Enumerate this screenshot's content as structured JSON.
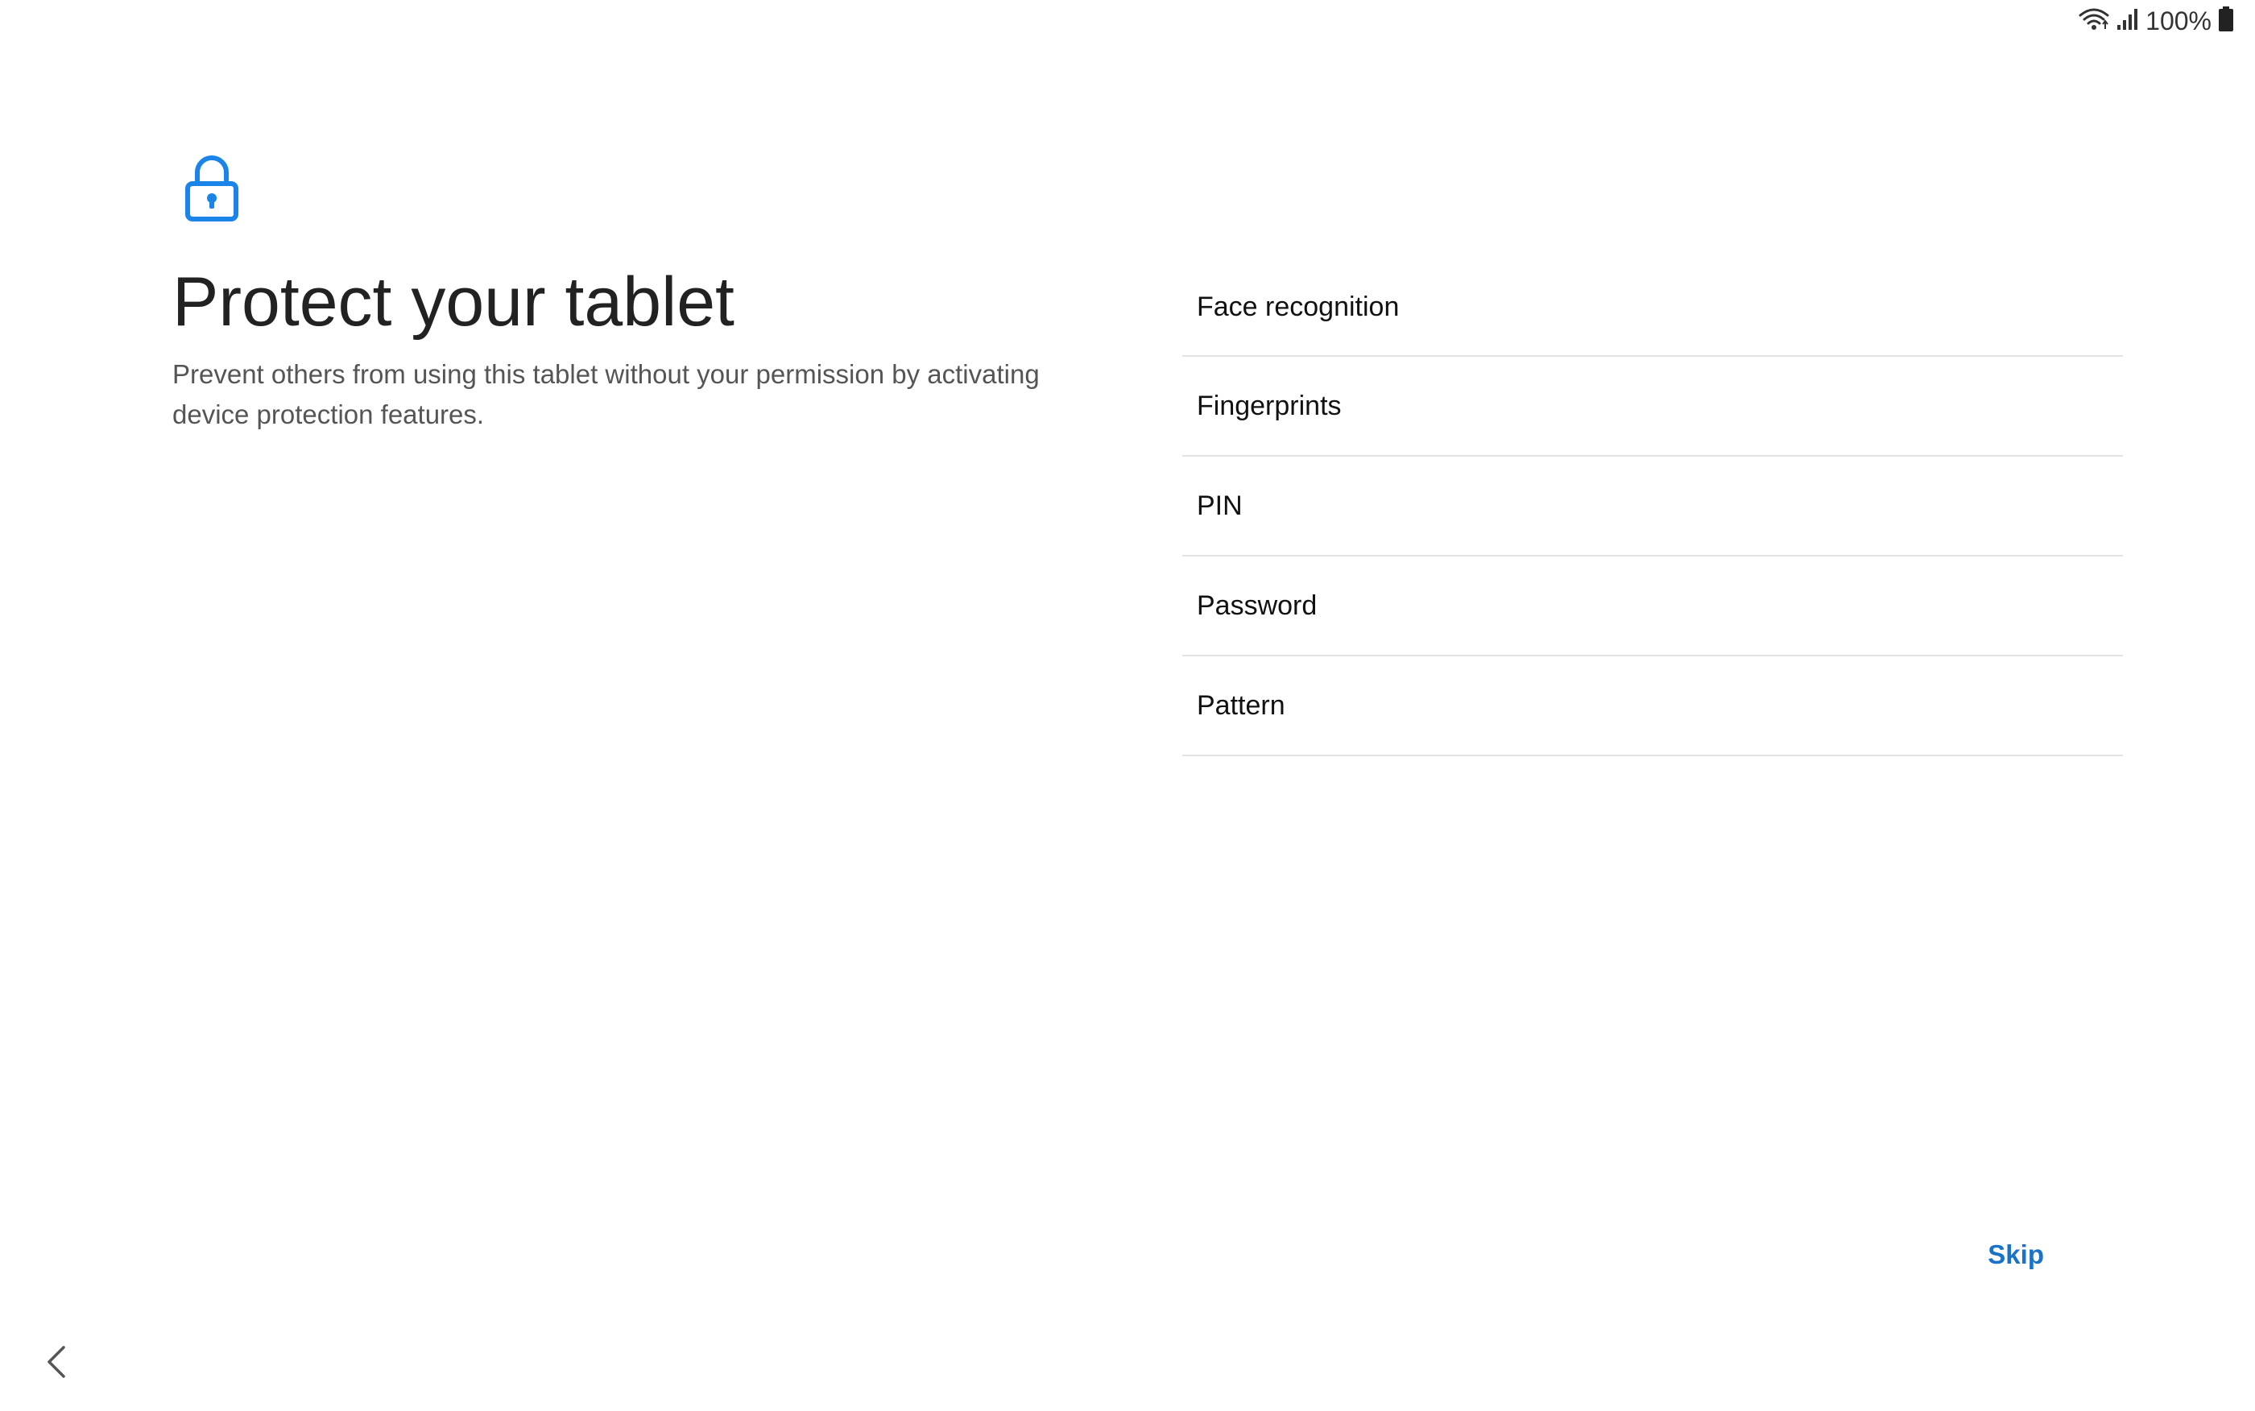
{
  "status_bar": {
    "battery_percent": "100%",
    "icons": [
      "wifi-icon",
      "signal-icon",
      "battery-icon"
    ]
  },
  "header": {
    "icon": "lock-icon",
    "title": "Protect your tablet",
    "description": "Prevent others from using this tablet without your permission by activating device protection features."
  },
  "options": [
    {
      "label": "Face recognition"
    },
    {
      "label": "Fingerprints"
    },
    {
      "label": "PIN"
    },
    {
      "label": "Password"
    },
    {
      "label": "Pattern"
    }
  ],
  "footer": {
    "skip_label": "Skip",
    "back_icon": "chevron-left-icon"
  },
  "colors": {
    "accent": "#1a73c9",
    "lock_icon": "#1a84e8",
    "title": "#222222",
    "subtitle": "#555555",
    "divider": "#e4e4e4"
  }
}
